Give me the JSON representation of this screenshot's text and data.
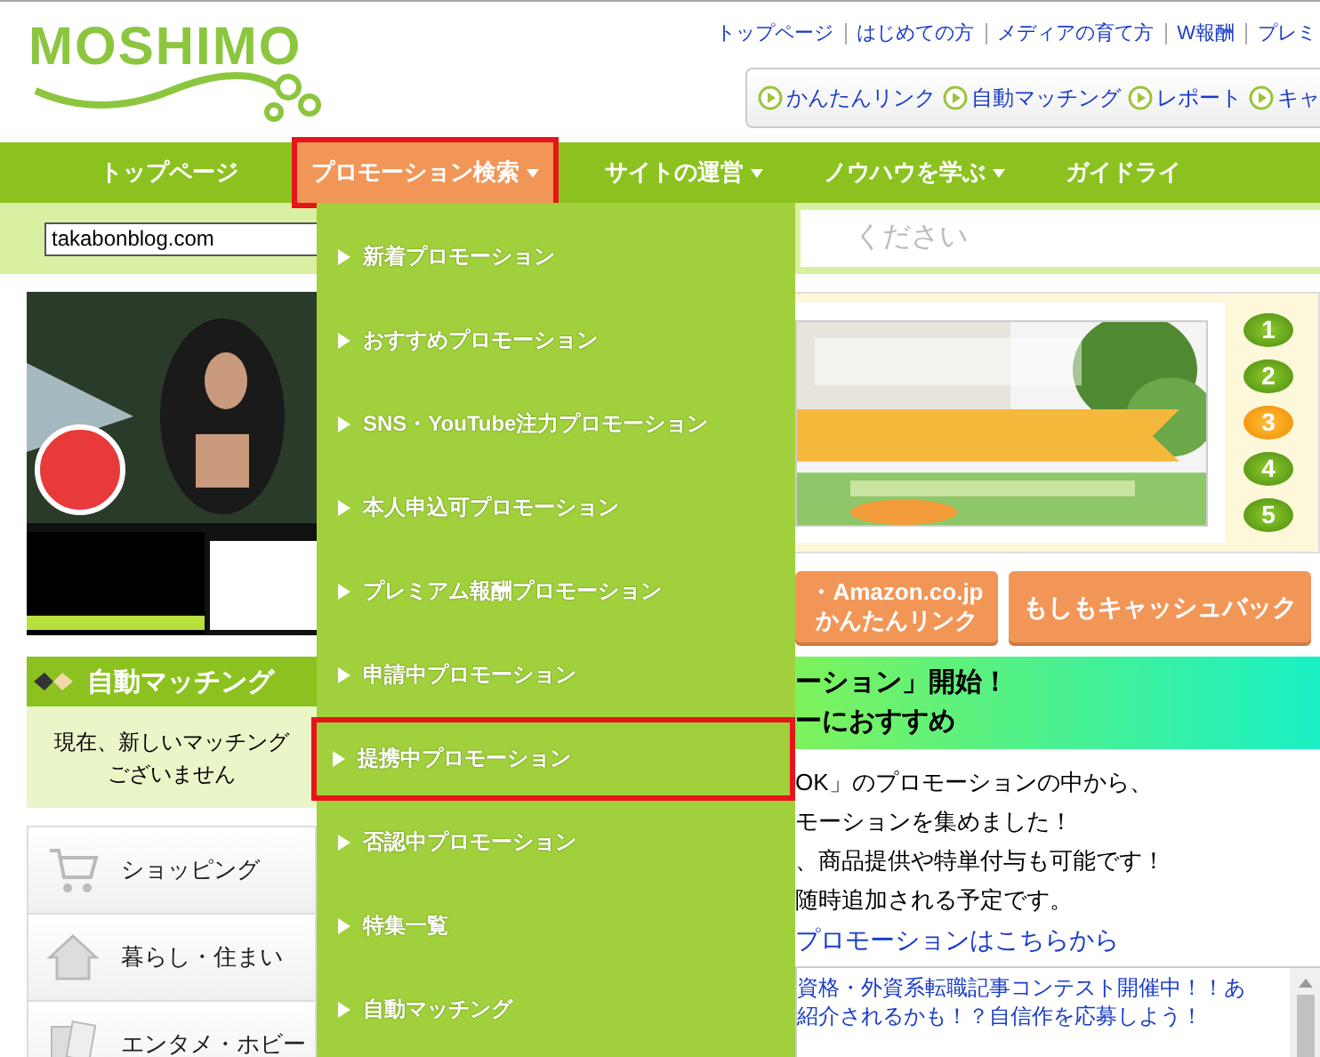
{
  "header": {
    "logo": "MOSHIMO",
    "top_links": [
      "トップページ",
      "はじめての方",
      "メディアの育て方",
      "W報酬",
      "プレミ"
    ],
    "quick_links": [
      "かんたんリンク",
      "自動マッチング",
      "レポート",
      "キャ"
    ]
  },
  "nav": [
    {
      "label": "トップページ",
      "selected": false,
      "has_menu": false
    },
    {
      "label": "プロモーション検索",
      "selected": true,
      "has_menu": true
    },
    {
      "label": "サイトの運営",
      "selected": false,
      "has_menu": true
    },
    {
      "label": "ノウハウを学ぶ",
      "selected": false,
      "has_menu": true
    },
    {
      "label": "ガイドライ",
      "selected": false,
      "has_menu": false
    }
  ],
  "search": {
    "site": "takabonblog.com",
    "placeholder": "ください"
  },
  "dropdown": [
    {
      "label": "新着プロモーション",
      "selected": false
    },
    {
      "label": "おすすめプロモーション",
      "selected": false
    },
    {
      "label": "SNS・YouTube注力プロモーション",
      "selected": false
    },
    {
      "label": "本人申込可プロモーション",
      "selected": false
    },
    {
      "label": "プレミアム報酬プロモーション",
      "selected": false
    },
    {
      "label": "申請中プロモーション",
      "selected": false
    },
    {
      "label": "提携中プロモーション",
      "selected": true
    },
    {
      "label": "否認中プロモーション",
      "selected": false
    },
    {
      "label": "特集一覧",
      "selected": false
    },
    {
      "label": "自動マッチング",
      "selected": false
    }
  ],
  "sidebar": {
    "matching_title": "自動マッチング",
    "matching_message": [
      "現在、新しいマッチング",
      "ございません"
    ],
    "categories": [
      {
        "label": "ショッピング",
        "kind": "cart"
      },
      {
        "label": "暮らし・住まい",
        "kind": "house"
      },
      {
        "label": "エンタメ・ホビー",
        "kind": "cards"
      }
    ]
  },
  "slider": {
    "pages": [
      {
        "label": "1",
        "selected": false
      },
      {
        "label": "2",
        "selected": false
      },
      {
        "label": "3",
        "selected": true
      },
      {
        "label": "4",
        "selected": false
      },
      {
        "label": "5",
        "selected": false
      }
    ]
  },
  "buttons": [
    {
      "lines": [
        "・Amazon.co.jp",
        "かんたんリンク"
      ]
    },
    {
      "lines": [
        "もしもキャッシュバック"
      ]
    }
  ],
  "feature": {
    "heading": [
      "ーション」開始！",
      "ーにおすすめ"
    ],
    "body": [
      "OK」のプロモーションの中から、",
      "モーションを集めました！",
      "、商品提供や特単付与も可能です！",
      "随時追加される予定です。"
    ],
    "link": "プロモーションはこちらから"
  },
  "news": [
    "資格・外資系転職記事コンテスト開催中！！あ",
    "紹介されるかも！？自信作を応募しよう！"
  ]
}
